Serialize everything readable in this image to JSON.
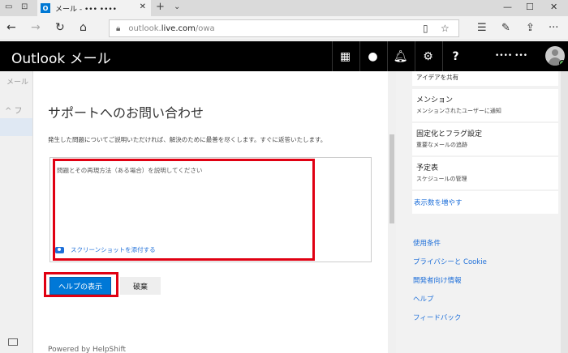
{
  "browser": {
    "tab_title": "メール - ••• ••••",
    "tab_icon_letter": "O",
    "url_prefix": "outlook.",
    "url_domain": "live.com",
    "url_path": "/owa"
  },
  "header": {
    "app_title": "Outlook メール",
    "user_name": "•••• •••"
  },
  "background": {
    "left_strip_text": "メール",
    "left_folder_text": "^ フ"
  },
  "dialog": {
    "title": "サポートへのお問い合わせ",
    "description": "発生した問題についてご説明いただければ、解決のために最善を尽くします。すぐに返答いたします。",
    "textarea_placeholder": "問題とその再現方法（ある場合）を説明してください",
    "attach_label": "スクリーンショットを添付する",
    "help_button": "ヘルプの表示",
    "discard_button": "破棄",
    "powered_by": "Powered by HelpShift"
  },
  "right_panel": {
    "top_card": "アイデアを共有",
    "cards": [
      {
        "title": "メンション",
        "subtitle": "メンションされたユーザーに通知"
      },
      {
        "title": "固定化とフラグ設定",
        "subtitle": "重要なメールの追跡"
      },
      {
        "title": "予定表",
        "subtitle": "スケジュールの管理"
      }
    ],
    "more_link": "表示数を増やす",
    "links": [
      "使用条件",
      "プライバシーと Cookie",
      "開発者向け情報",
      "ヘルプ",
      "フィードバック"
    ]
  },
  "colors": {
    "accent": "#0078d7",
    "highlight_box": "#e00012",
    "link": "#1e6fd9",
    "header_bg": "#000000"
  }
}
